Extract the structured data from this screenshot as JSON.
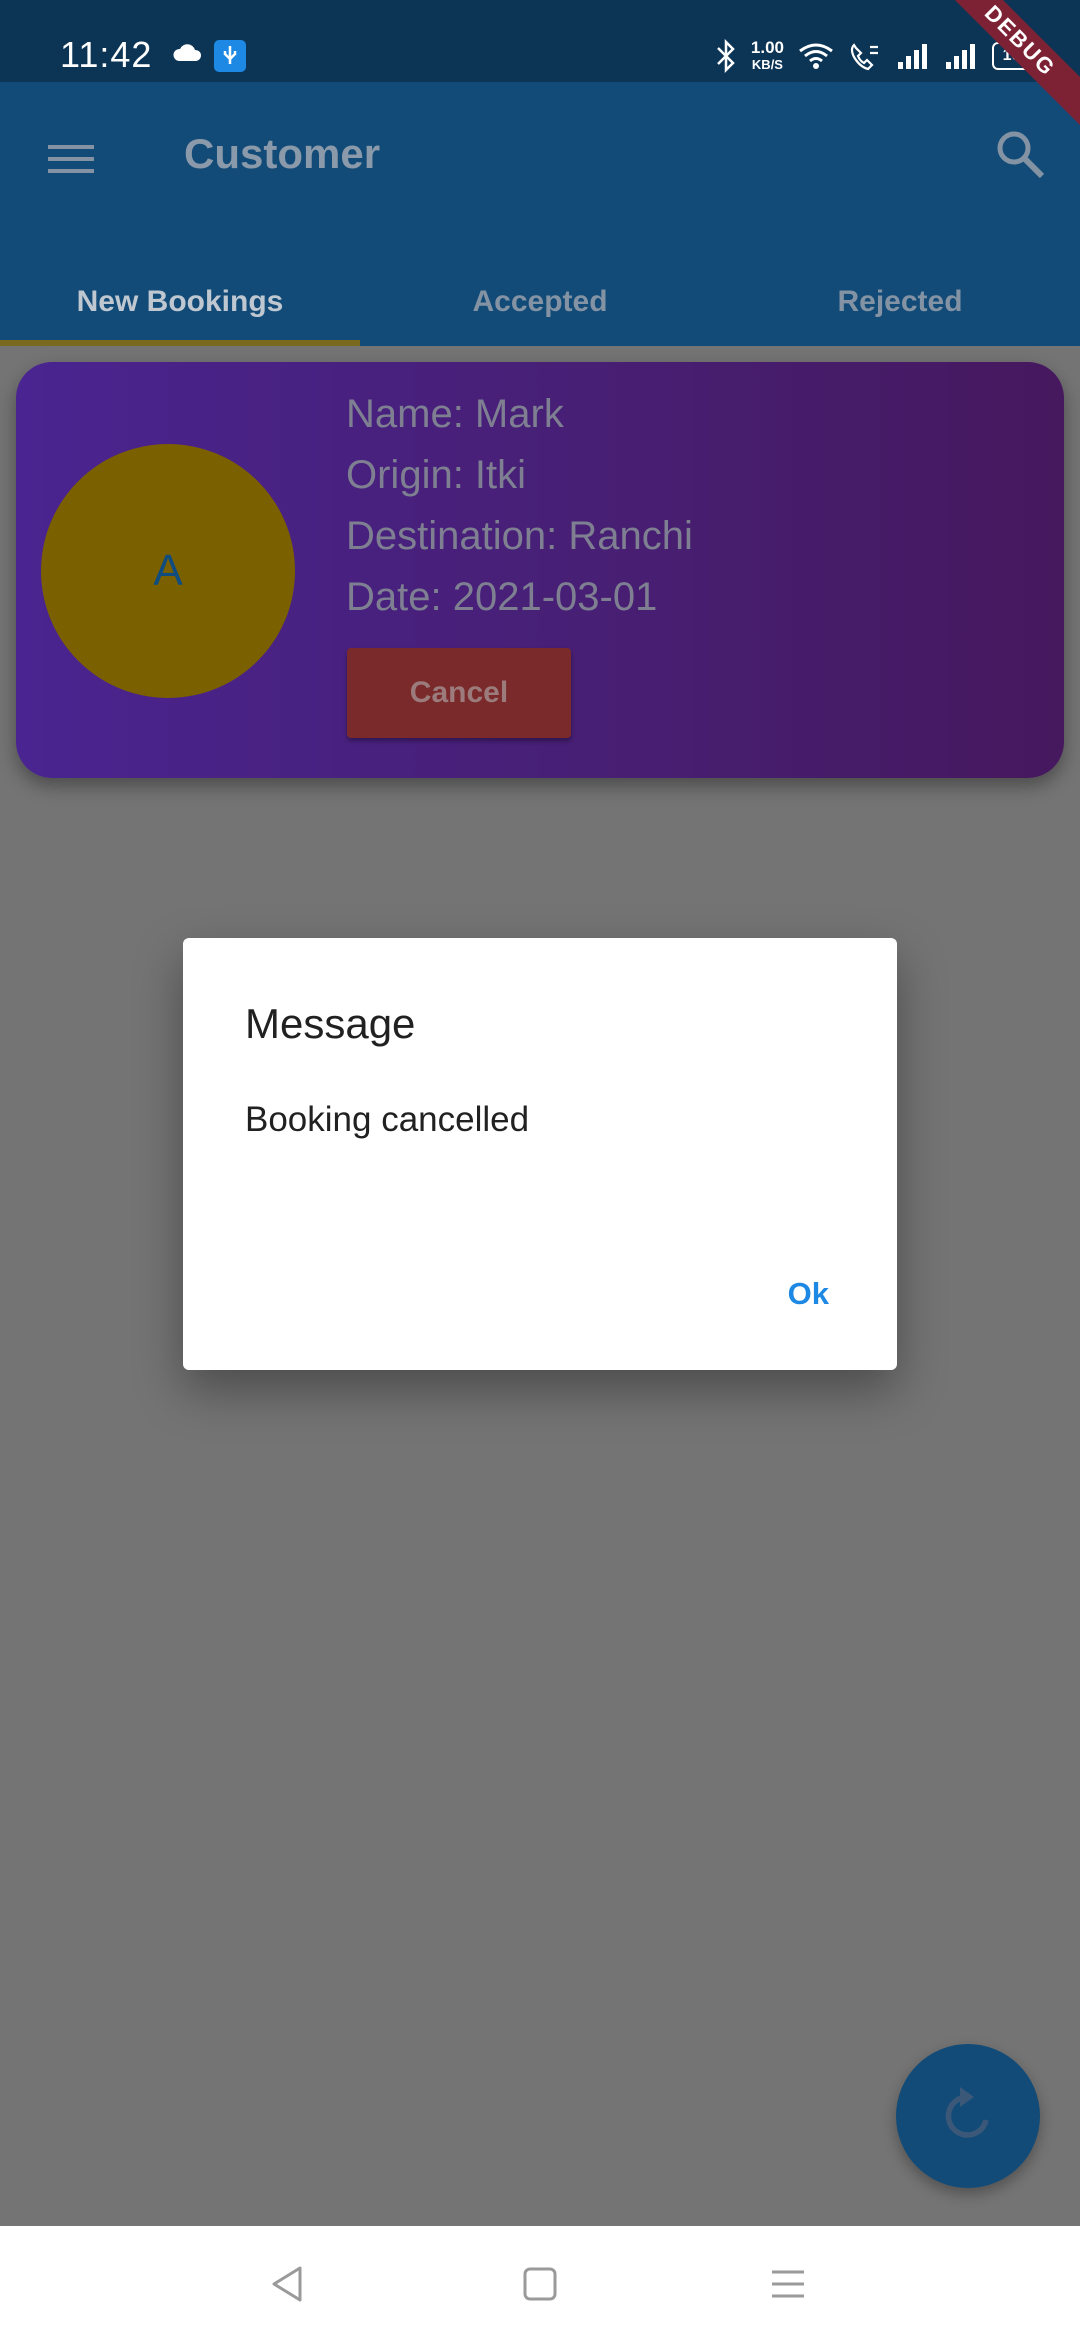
{
  "status_bar": {
    "time": "11:42",
    "net_rate_value": "1.00",
    "net_rate_unit": "KB/S",
    "battery": "100",
    "debug_label": "DEBUG"
  },
  "app_bar": {
    "title": "Customer",
    "tabs": [
      {
        "label": "New Bookings",
        "active": true
      },
      {
        "label": "Accepted",
        "active": false
      },
      {
        "label": "Rejected",
        "active": false
      }
    ]
  },
  "booking": {
    "avatar_letter": "A",
    "name": "Name: Mark",
    "origin": "Origin: Itki",
    "destination": "Destination: Ranchi",
    "date": "Date: 2021-03-01",
    "cancel_label": "Cancel"
  },
  "dialog": {
    "title": "Message",
    "body": "Booking cancelled",
    "ok_label": "Ok"
  },
  "icons": {
    "menu": "menu-icon",
    "search": "search-icon",
    "refresh": "refresh-icon",
    "back": "back-triangle-icon",
    "home": "home-square-icon",
    "recents": "recents-lines-icon"
  },
  "colors": {
    "app_bar": "#124b78",
    "status_bar": "#0b3455",
    "card_start": "#4a2490",
    "card_end": "#46185e",
    "avatar": "#7b6000",
    "cancel_button": "#7a2a2a",
    "dialog_action": "#1e88e5",
    "scrim": "#747474"
  }
}
